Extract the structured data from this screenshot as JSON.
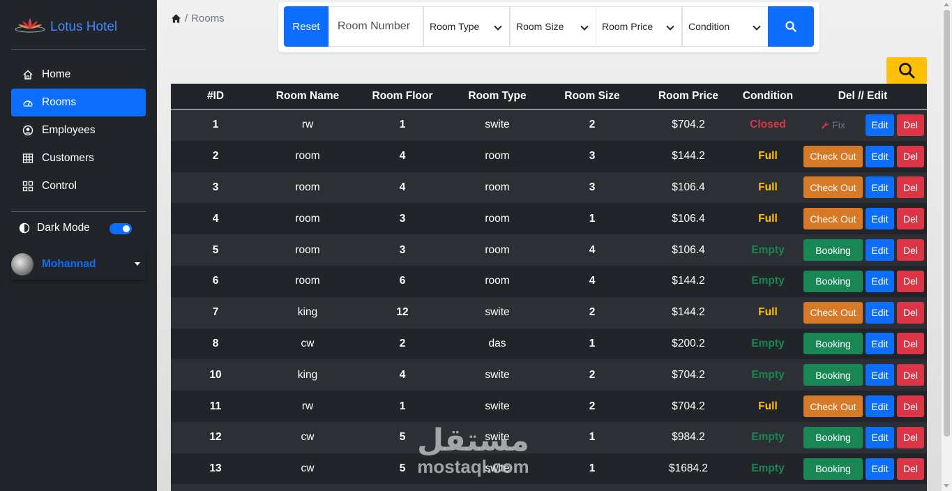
{
  "sidebar": {
    "brand": "Lotus Hotel",
    "nav": [
      {
        "label": "Home",
        "icon": "home-icon"
      },
      {
        "label": "Rooms",
        "icon": "dashboard-icon"
      },
      {
        "label": "Employees",
        "icon": "user-circle-icon"
      },
      {
        "label": "Customers",
        "icon": "table-icon"
      },
      {
        "label": "Control",
        "icon": "grid-icon"
      }
    ],
    "dark_mode_label": "Dark Mode",
    "dark_mode_on": true,
    "user_name": "Mohannad"
  },
  "breadcrumb": {
    "current": "Rooms"
  },
  "filters": {
    "reset_label": "Reset",
    "room_number_placeholder": "Room Number",
    "selects": [
      "Room Type",
      "Room Size",
      "Room Price",
      "Condition"
    ]
  },
  "table": {
    "headers": [
      "#ID",
      "Room Name",
      "Room Floor",
      "Room Type",
      "Room Size",
      "Room Price",
      "Condition",
      "Del // Edit"
    ],
    "rows": [
      {
        "id": "1",
        "name": "rw",
        "floor": "1",
        "type": "swite",
        "size": "2",
        "price": "$704.2",
        "condition": "Closed",
        "action": "Fix"
      },
      {
        "id": "2",
        "name": "room",
        "floor": "4",
        "type": "room",
        "size": "3",
        "price": "$144.2",
        "condition": "Full",
        "action": "Check Out"
      },
      {
        "id": "3",
        "name": "room",
        "floor": "4",
        "type": "room",
        "size": "3",
        "price": "$106.4",
        "condition": "Full",
        "action": "Check Out"
      },
      {
        "id": "4",
        "name": "room",
        "floor": "3",
        "type": "room",
        "size": "1",
        "price": "$106.4",
        "condition": "Full",
        "action": "Check Out"
      },
      {
        "id": "5",
        "name": "room",
        "floor": "3",
        "type": "room",
        "size": "4",
        "price": "$106.4",
        "condition": "Empty",
        "action": "Booking"
      },
      {
        "id": "6",
        "name": "room",
        "floor": "6",
        "type": "room",
        "size": "4",
        "price": "$144.2",
        "condition": "Empty",
        "action": "Booking"
      },
      {
        "id": "7",
        "name": "king",
        "floor": "12",
        "type": "swite",
        "size": "2",
        "price": "$144.2",
        "condition": "Full",
        "action": "Check Out"
      },
      {
        "id": "8",
        "name": "cw",
        "floor": "2",
        "type": "das",
        "size": "1",
        "price": "$200.2",
        "condition": "Empty",
        "action": "Booking"
      },
      {
        "id": "10",
        "name": "king",
        "floor": "4",
        "type": "swite",
        "size": "2",
        "price": "$704.2",
        "condition": "Empty",
        "action": "Booking"
      },
      {
        "id": "11",
        "name": "rw",
        "floor": "1",
        "type": "swite",
        "size": "2",
        "price": "$704.2",
        "condition": "Full",
        "action": "Check Out"
      },
      {
        "id": "12",
        "name": "cw",
        "floor": "5",
        "type": "swite",
        "size": "1",
        "price": "$984.2",
        "condition": "Empty",
        "action": "Booking"
      },
      {
        "id": "13",
        "name": "cw",
        "floor": "5",
        "type": "swite",
        "size": "1",
        "price": "$1684.2",
        "condition": "Empty",
        "action": "Booking"
      }
    ],
    "edit_label": "Edit",
    "del_label": "Del"
  },
  "watermark": {
    "arabic": "مستقل",
    "latin": "mostaql.com"
  },
  "colors": {
    "primary": "#0d6efd",
    "sidebar": "#212529",
    "danger": "#dc3545",
    "warning": "#ffc107",
    "success": "#198754",
    "checkout": "#d77a27"
  }
}
